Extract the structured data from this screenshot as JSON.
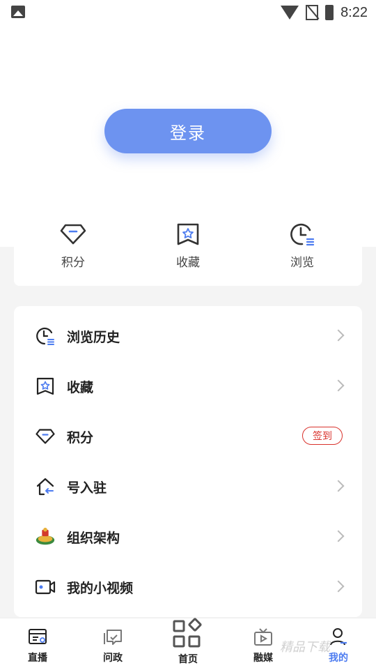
{
  "status_bar": {
    "time": "8:22"
  },
  "header": {
    "login_label": "登录"
  },
  "quick_actions": [
    {
      "label": "积分",
      "icon": "diamond-icon"
    },
    {
      "label": "收藏",
      "icon": "star-bookmark-icon"
    },
    {
      "label": "浏览",
      "icon": "clock-icon"
    }
  ],
  "menu": [
    {
      "label": "浏览历史",
      "icon": "history-icon"
    },
    {
      "label": "收藏",
      "icon": "star-bookmark-icon"
    },
    {
      "label": "积分",
      "icon": "diamond-icon",
      "badge": "签到"
    },
    {
      "label": "号入驻",
      "icon": "house-arrow-icon"
    },
    {
      "label": "组织架构",
      "icon": "organization-logo-icon"
    },
    {
      "label": "我的小视频",
      "icon": "video-camera-icon"
    }
  ],
  "tabbar": [
    {
      "label": "直播",
      "icon": "live-icon"
    },
    {
      "label": "问政",
      "icon": "question-icon"
    },
    {
      "label": "首页",
      "icon": "home-grid-icon"
    },
    {
      "label": "融媒",
      "icon": "tv-icon"
    },
    {
      "label": "我的",
      "icon": "user-icon",
      "active": true
    }
  ],
  "watermark": "精品下载",
  "colors": {
    "accent": "#6d93f0",
    "active_tab": "#4d7cf0",
    "badge": "#d9322c"
  }
}
